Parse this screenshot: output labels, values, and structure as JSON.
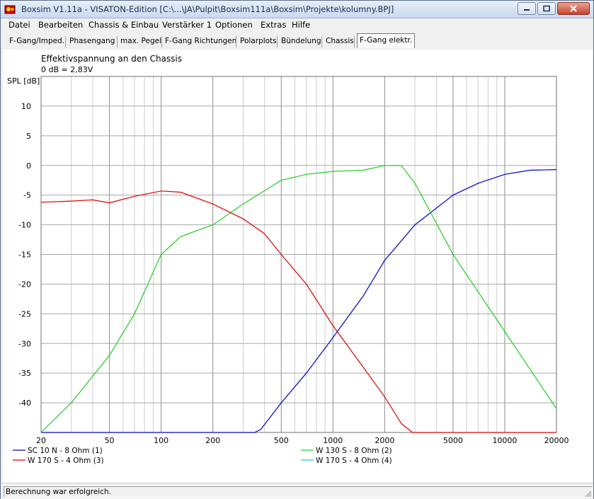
{
  "window": {
    "title": "Boxsim V1.11a - VISATON-Edition [C:\\...\\JA\\Pulpit\\Boxsim111a\\Boxsim\\Projekte\\kolumny.BPJ]",
    "icon": "boxsim-app-icon",
    "controls": [
      "minimize-icon",
      "maximize-icon",
      "close-icon"
    ]
  },
  "menu": [
    "Datei",
    "Bearbeiten",
    "Chassis & Einbau",
    "Verstärker 1",
    "Optionen",
    "Extras",
    "Hilfe"
  ],
  "tabs": [
    {
      "label": "F-Gang/Imped."
    },
    {
      "label": "Phasengang"
    },
    {
      "label": "max. Pegel"
    },
    {
      "label": "F-Gang Richtungen"
    },
    {
      "label": "Polarplots"
    },
    {
      "label": "Bündelung"
    },
    {
      "label": "Chassis"
    },
    {
      "label": "F-Gang elektr.",
      "active": true
    }
  ],
  "chart": {
    "title": "Effektivspannung an den Chassis",
    "subtitle": "0 dB = 2,83V",
    "ylabel": "SPL [dB]"
  },
  "chart_data": {
    "type": "line",
    "xscale": "log",
    "xlim": [
      20,
      20000
    ],
    "ylim": [
      -45,
      15
    ],
    "grid": true,
    "xticks": [
      "20",
      "50",
      "100",
      "200",
      "500",
      "1000",
      "2000",
      "5000",
      "10000",
      "20000"
    ],
    "yticks": [
      "10",
      "5",
      "0",
      "-5",
      "-10",
      "-15",
      "-20",
      "-25",
      "-30",
      "-35",
      "-40"
    ],
    "legend_position": "bottom",
    "series": [
      {
        "name": "SC 10 N - 8 Ohm (1)",
        "color": "#0000cc",
        "x": [
          20,
          100,
          200,
          350,
          380,
          500,
          700,
          1000,
          1500,
          2000,
          3000,
          5000,
          7000,
          10000,
          14000,
          20000
        ],
        "y": [
          -45,
          -45,
          -45,
          -45,
          -44.5,
          -40,
          -35,
          -29,
          -22,
          -16,
          -10,
          -5,
          -3,
          -1.5,
          -0.8,
          -0.7
        ]
      },
      {
        "name": "W 130 S - 8 Ohm (2)",
        "color": "#22cc22",
        "x": [
          20,
          30,
          50,
          70,
          100,
          130,
          200,
          300,
          500,
          700,
          1000,
          1500,
          2000,
          2500,
          3000,
          5000,
          10000,
          20000
        ],
        "y": [
          -45,
          -40,
          -32,
          -25,
          -15,
          -12,
          -10,
          -6.5,
          -2.5,
          -1.5,
          -1,
          -0.8,
          0,
          0,
          -3,
          -15,
          -28,
          -41
        ]
      },
      {
        "name": "W 170 S - 4 Ohm (3)",
        "color": "#dd0000",
        "x": [
          20,
          30,
          40,
          50,
          70,
          100,
          130,
          200,
          300,
          400,
          500,
          700,
          1000,
          1500,
          2000,
          2500,
          2900,
          3100,
          5000,
          10000,
          20000
        ],
        "y": [
          -6.2,
          -6,
          -5.8,
          -6.3,
          -5.2,
          -4.3,
          -4.5,
          -6.5,
          -9,
          -11.5,
          -15,
          -20,
          -27,
          -34,
          -39,
          -43.5,
          -45,
          -45,
          -45,
          -45,
          -45
        ]
      },
      {
        "name": "W 170 S - 4 Ohm (4)",
        "color": "#22cccc",
        "x": [],
        "y": []
      }
    ]
  },
  "status": "Berechnung war erfolgreich."
}
